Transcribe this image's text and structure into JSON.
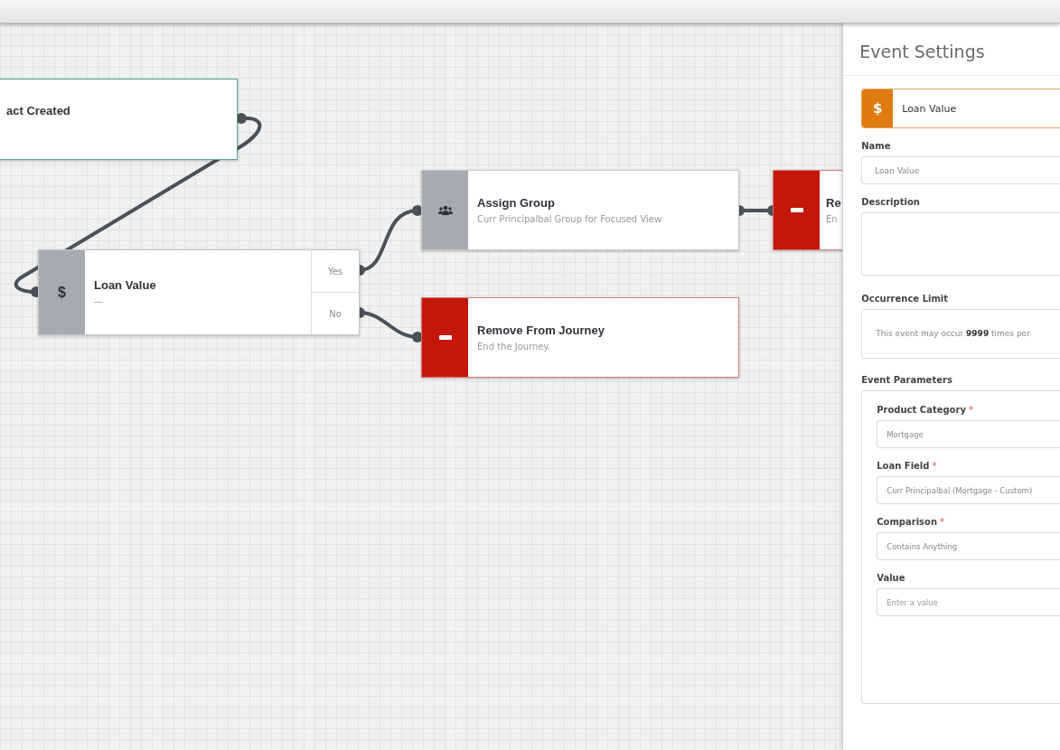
{
  "canvas": {
    "nodes": [
      {
        "kind": "trigger",
        "title": "act Created"
      },
      {
        "kind": "condition",
        "symbol": "$",
        "title": "Loan Value",
        "subtitle": "—",
        "branches": [
          "Yes",
          "No"
        ]
      },
      {
        "kind": "action",
        "title": "Assign Group",
        "subtitle": "Curr Principalbal Group for Focused View"
      },
      {
        "kind": "exit",
        "title": "Remove From Journey",
        "subtitle": "End the Journey."
      },
      {
        "kind": "exit",
        "title": "Re",
        "subtitle": "En"
      }
    ]
  },
  "panel": {
    "title": "Event Settings",
    "event": {
      "symbol": "$",
      "label": "Loan Value"
    },
    "name": {
      "label": "Name",
      "value": "Loan Value"
    },
    "description": {
      "label": "Description"
    },
    "occurrence": {
      "label": "Occurrence Limit",
      "text": "This event may occur **9999** times per"
    },
    "parameters": {
      "label": "Event Parameters",
      "fields": [
        {
          "label": "Product Category",
          "required_mark": "*",
          "value": "Mortgage"
        },
        {
          "label": "Loan Field",
          "required_mark": "*",
          "value": "Curr Principalbal (Mortgage - Custom)"
        },
        {
          "label": "Comparison",
          "required_mark": "*",
          "value": "Contains Anything"
        },
        {
          "label": "Value",
          "placeholder": "Enter a value"
        }
      ]
    }
  }
}
